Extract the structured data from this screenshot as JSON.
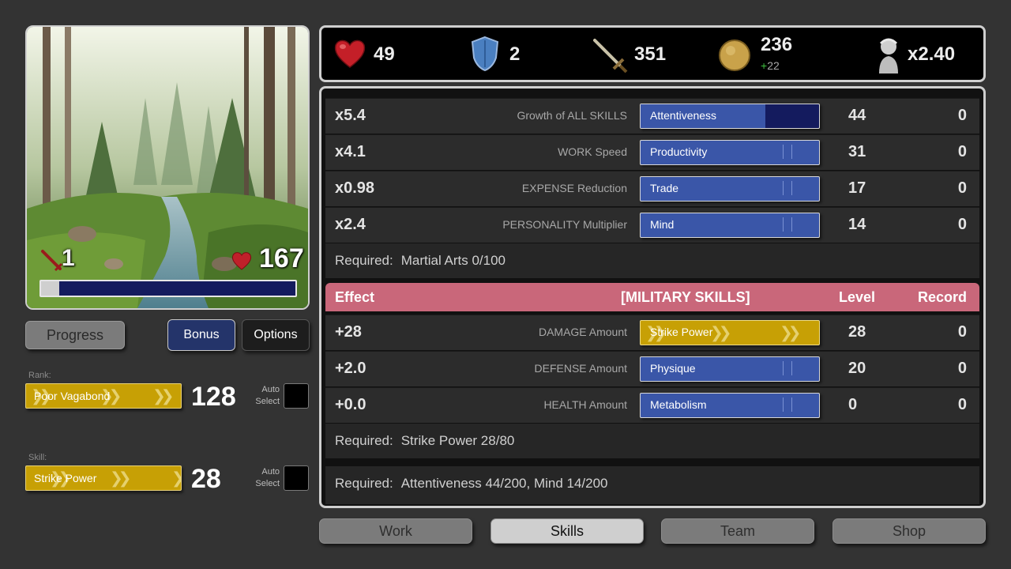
{
  "scene": {
    "weapon_count": "1",
    "health": "167",
    "progress_fraction": 0.07
  },
  "buttons": {
    "progress": "Progress",
    "bonus": "Bonus",
    "options": "Options"
  },
  "rank": {
    "label": "Rank:",
    "name": "Poor Vagabond",
    "value": "128",
    "auto_select": "Auto\nSelect"
  },
  "skill": {
    "label": "Skill:",
    "name": "Strike Power",
    "value": "28",
    "auto_select": "Auto\nSelect"
  },
  "stats": {
    "health": "49",
    "defense": "2",
    "attack": "351",
    "coins": "236",
    "coins_delta": "+22",
    "multiplier": "x2.40"
  },
  "mind_skills": [
    {
      "mult": "x5.4",
      "desc": "Growth of ALL SKILLS",
      "skill": "Attentiveness",
      "level": "44",
      "record": "0",
      "progress": 0.7
    },
    {
      "mult": "x4.1",
      "desc": "WORK Speed",
      "skill": "Productivity",
      "level": "31",
      "record": "0",
      "progress": 0
    },
    {
      "mult": "x0.98",
      "desc": "EXPENSE Reduction",
      "skill": "Trade",
      "level": "17",
      "record": "0",
      "progress": 0
    },
    {
      "mult": "x2.4",
      "desc": "PERSONALITY Multiplier",
      "skill": "Mind",
      "level": "14",
      "record": "0",
      "progress": 0
    }
  ],
  "mind_required": {
    "label": "Required:",
    "text": "Martial Arts 0/100"
  },
  "military_header": {
    "effect": "Effect",
    "title": "[MILITARY SKILLS]",
    "level": "Level",
    "record": "Record"
  },
  "military_skills": [
    {
      "mult": "+28",
      "desc": "DAMAGE Amount",
      "skill": "Strike Power",
      "level": "28",
      "record": "0",
      "active": true
    },
    {
      "mult": "+2.0",
      "desc": "DEFENSE Amount",
      "skill": "Physique",
      "level": "20",
      "record": "0",
      "active": false
    },
    {
      "mult": "+0.0",
      "desc": "HEALTH Amount",
      "skill": "Metabolism",
      "level": "0",
      "record": "0",
      "active": false
    }
  ],
  "military_required": {
    "label": "Required:",
    "text": "Strike Power 28/80"
  },
  "next_required": {
    "label": "Required:",
    "text": "Attentiveness 44/200,  Mind 14/200"
  },
  "tabs": [
    "Work",
    "Skills",
    "Team",
    "Shop"
  ],
  "active_tab": "Skills",
  "colors": {
    "skill_blue": "#3a56a8",
    "skill_dark": "#141b5e",
    "skill_gold": "#c7a005",
    "military_header": "#c9677a"
  }
}
